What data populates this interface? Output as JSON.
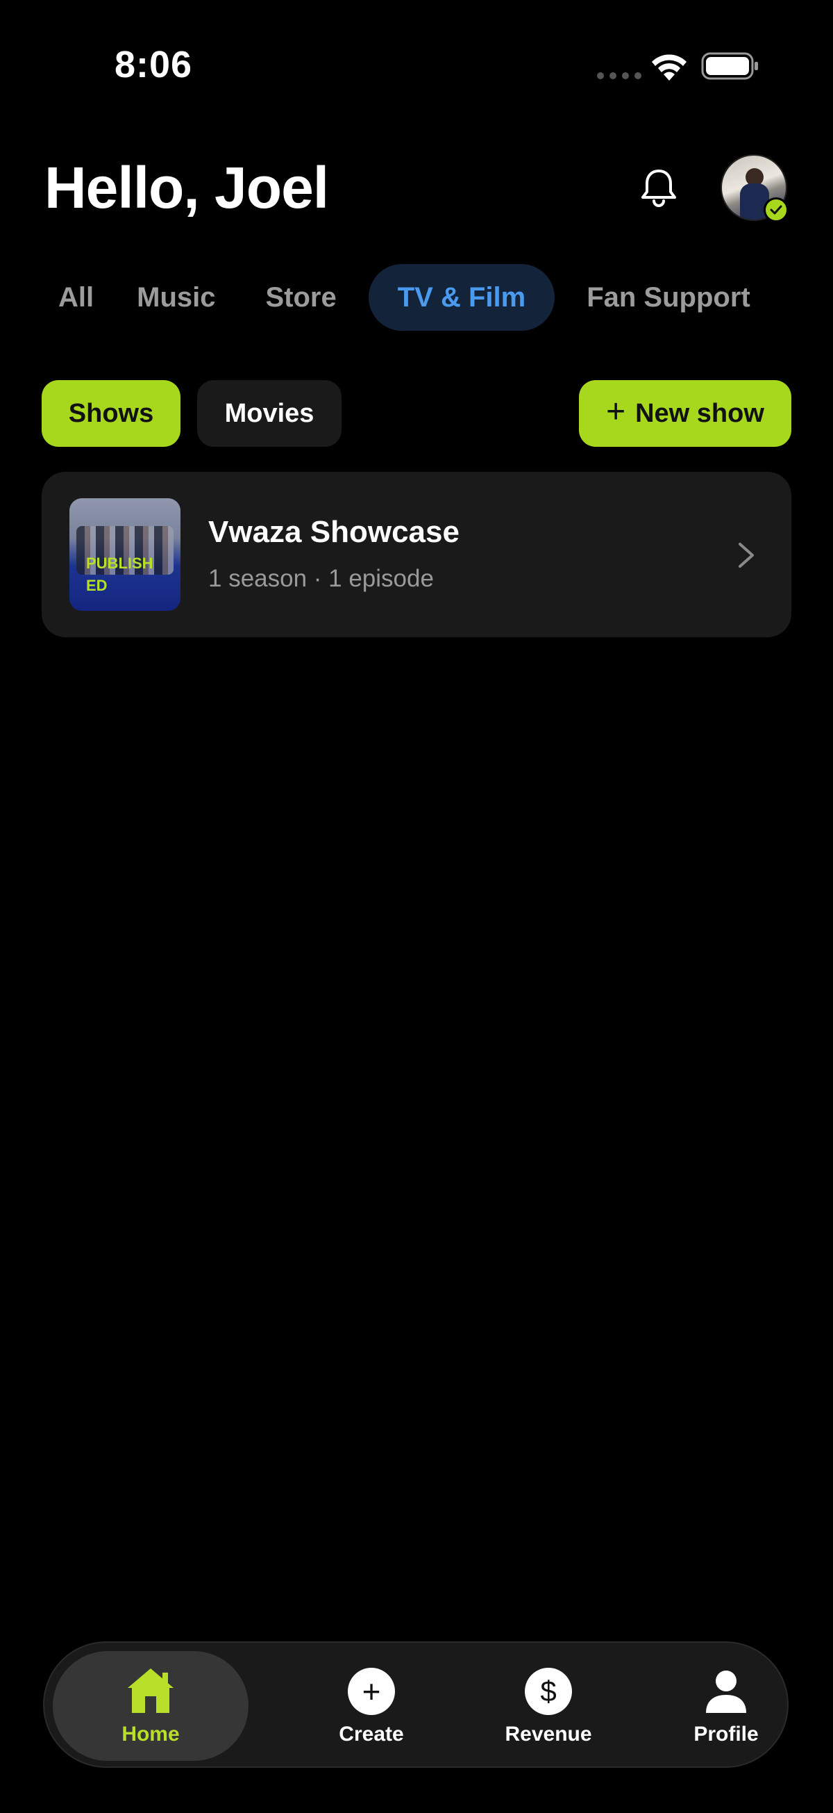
{
  "status_bar": {
    "time": "8:06"
  },
  "header": {
    "greeting": "Hello, Joel"
  },
  "tabs": [
    {
      "label": "All",
      "active": false
    },
    {
      "label": "Music",
      "active": false
    },
    {
      "label": "Store",
      "active": false
    },
    {
      "label": "TV & Film",
      "active": true
    },
    {
      "label": "Fan Support",
      "active": false
    }
  ],
  "filters": {
    "shows_label": "Shows",
    "movies_label": "Movies",
    "selected": "Shows",
    "new_show_label": "New show"
  },
  "shows": [
    {
      "title": "Vwaza Showcase",
      "subtitle": "1 season · 1 episode",
      "badge": "PUBLISHED"
    }
  ],
  "bottom_nav": {
    "home_label": "Home",
    "create_label": "Create",
    "revenue_label": "Revenue",
    "profile_label": "Profile",
    "active": "Home"
  },
  "colors": {
    "accent": "#a8d81e",
    "active_tab_text": "#4a9bf0",
    "active_tab_bg": "#13233a",
    "card_bg": "#1a1a1a",
    "background": "#000000"
  },
  "icons": {
    "bell": "bell-icon",
    "home": "home-icon",
    "create": "plus-circle-icon",
    "revenue": "dollar-circle-icon",
    "profile": "person-icon",
    "chevron": "chevron-right-icon",
    "verified": "check-badge-icon"
  }
}
